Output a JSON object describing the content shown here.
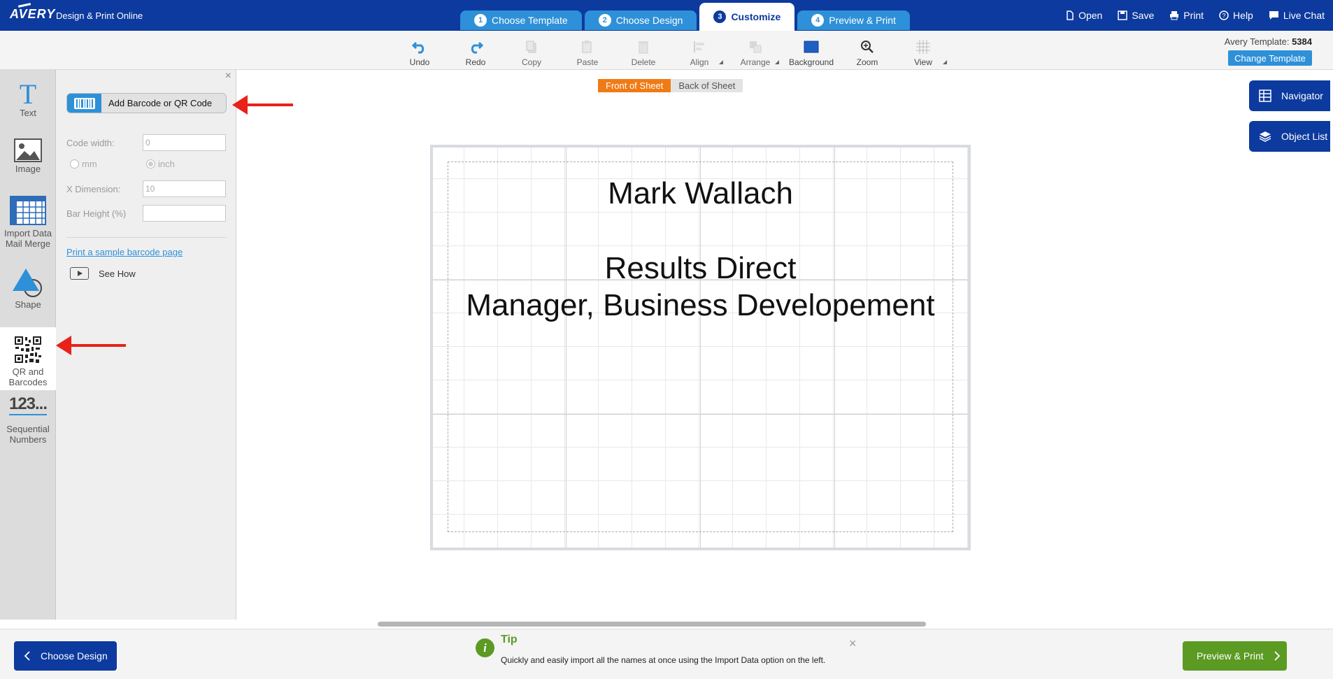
{
  "topbar": {
    "logo": "AVERY",
    "product": "Design & Print Online",
    "steps": [
      {
        "num": "1",
        "label": "Choose Template"
      },
      {
        "num": "2",
        "label": "Choose Design"
      },
      {
        "num": "3",
        "label": "Customize"
      },
      {
        "num": "4",
        "label": "Preview & Print"
      }
    ],
    "links": {
      "open": "Open",
      "save": "Save",
      "print": "Print",
      "help": "Help",
      "chat": "Live Chat"
    }
  },
  "toolbar": {
    "tools": [
      "Undo",
      "Redo",
      "Copy",
      "Paste",
      "Delete",
      "Align",
      "Arrange",
      "Background",
      "Zoom",
      "View"
    ],
    "template_label": "Avery Template:",
    "template_number": "5384",
    "change_template": "Change Template"
  },
  "rail": {
    "items": [
      {
        "label": "Text",
        "icon": "text-icon"
      },
      {
        "label": "Image",
        "icon": "image-icon"
      },
      {
        "label": "Import Data Mail Merge",
        "icon": "table-icon"
      },
      {
        "label": "Shape",
        "icon": "shape-icon"
      },
      {
        "label": "QR and Barcodes",
        "icon": "qr-code-icon"
      },
      {
        "label": "Sequential Numbers",
        "icon": "sequential-numbers-icon",
        "glyph": "123..."
      }
    ]
  },
  "panel": {
    "add_button": "Add Barcode or QR Code",
    "code_width_label": "Code width:",
    "code_width_value": "0",
    "unit_mm": "mm",
    "unit_inch": "inch",
    "selected_unit": "inch",
    "x_dimension_label": "X Dimension:",
    "x_dimension_value": "10",
    "bar_height_label": "Bar Height (%)",
    "bar_height_value": "",
    "sample_link": "Print a sample barcode page",
    "see_how": "See How"
  },
  "canvas": {
    "tab_front": "Front of Sheet",
    "tab_back": "Back of Sheet",
    "active_tab": "Front of Sheet",
    "lines": [
      "Mark Wallach",
      "Results Direct",
      "Manager, Business Developement"
    ],
    "navigator": "Navigator",
    "object_list": "Object List"
  },
  "bottom": {
    "back_button": "Choose Design",
    "tip_title": "Tip",
    "tip_text": "Quickly and easily import all the names at once using the Import Data option on the left.",
    "next_button": "Preview & Print"
  },
  "colors": {
    "brand": "#0d3a9e",
    "accent": "#2e90d8",
    "front_tab": "#f07b16",
    "success": "#5b9a23",
    "annotation_arrow": "#e8221a"
  }
}
